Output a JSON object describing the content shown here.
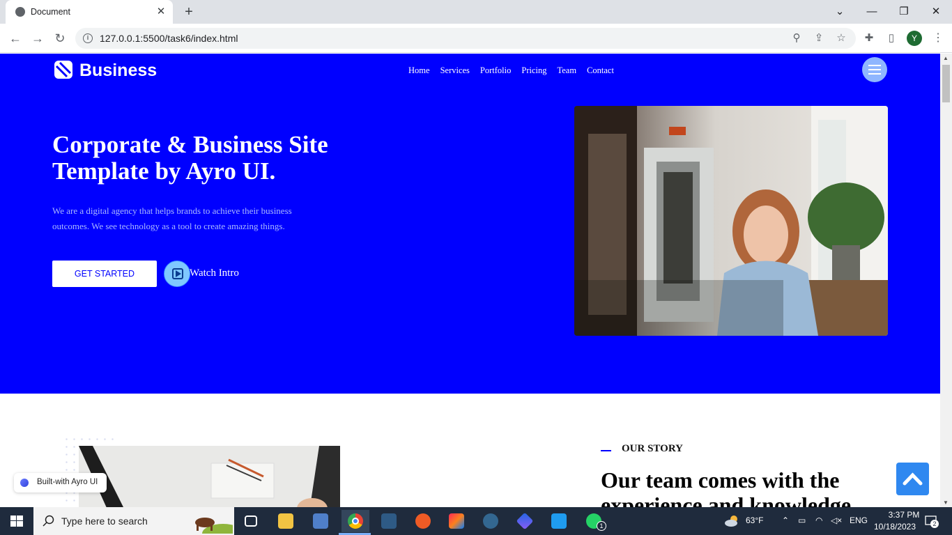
{
  "browser": {
    "tab_title": "Document",
    "url": "127.0.0.1:5500/task6/index.html",
    "profile_initial": "Y"
  },
  "site": {
    "brand": "Business",
    "nav": [
      "Home",
      "Services",
      "Portfolio",
      "Pricing",
      "Team",
      "Contact"
    ],
    "hero": {
      "title": "Corporate & Business Site Template by Ayro UI.",
      "text": "We are a digital agency that helps brands to achieve their business outcomes. We see technology as a tool to create amazing things.",
      "cta_label": "GET STARTED",
      "watch_label": "Watch Intro"
    },
    "story": {
      "tag": "OUR STORY",
      "title": "Our team comes with the experience and knowledge"
    },
    "built_badge": "Built-with Ayro UI"
  },
  "colors": {
    "hero_bg": "#0000ff",
    "accent": "#0000ff",
    "back_to_top": "#2f88f0"
  },
  "taskbar": {
    "search_placeholder": "Type here to search",
    "weather": "63°F",
    "language": "ENG",
    "time": "3:37 PM",
    "date": "10/18/2023",
    "whatsapp_badge": "1",
    "notification_count": "2"
  }
}
